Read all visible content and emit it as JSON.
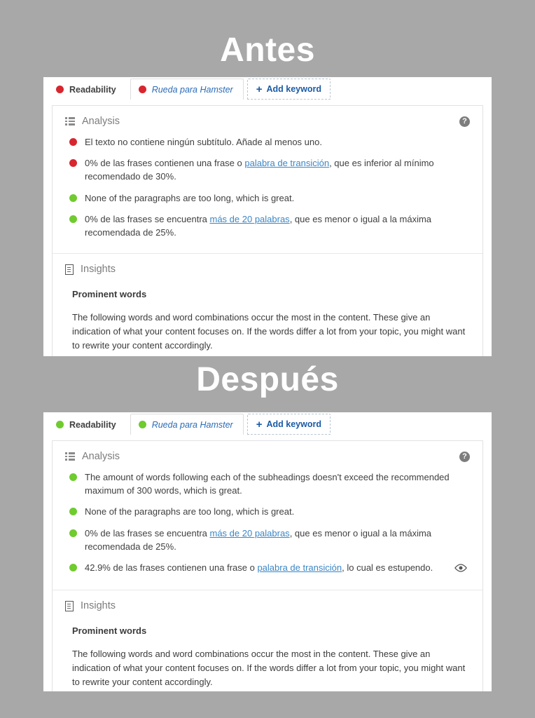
{
  "headings": {
    "before": "Antes",
    "after": "Después"
  },
  "panels": [
    {
      "id": "before",
      "tabs": {
        "readability": {
          "label": "Readability",
          "dot_color": "red"
        },
        "keyword": {
          "label": "Rueda para Hamster",
          "dot_color": "red"
        },
        "add_keyword": {
          "label": "Add keyword",
          "icon": "plus-icon"
        }
      },
      "analysis": {
        "title": "Analysis",
        "icon": "list-icon",
        "help_icon": "help-icon",
        "help_glyph": "?",
        "items": [
          {
            "bullet": "red",
            "parts": [
              {
                "type": "text",
                "value": "El texto no contiene ningún subtítulo. Añade al menos uno."
              }
            ]
          },
          {
            "bullet": "red",
            "parts": [
              {
                "type": "text",
                "value": "0% de las frases contienen una frase o "
              },
              {
                "type": "link",
                "value": "palabra de transición"
              },
              {
                "type": "text",
                "value": ", que es inferior al mínimo recomendado de 30%."
              }
            ]
          },
          {
            "bullet": "green",
            "parts": [
              {
                "type": "text",
                "value": "None of the paragraphs are too long, which is great."
              }
            ]
          },
          {
            "bullet": "green",
            "parts": [
              {
                "type": "text",
                "value": "0% de las frases se encuentra "
              },
              {
                "type": "link",
                "value": "más de 20 palabras"
              },
              {
                "type": "text",
                "value": ", que es menor o igual a la máxima recomendada de 25%."
              }
            ]
          }
        ]
      },
      "insights": {
        "title": "Insights",
        "icon": "doc-icon",
        "prominent_words_title": "Prominent words",
        "paragraph": "The following words and word combinations occur the most in the content. These give an indication of what your content focuses on. If the words differ a lot from your topic, you might want to rewrite your content accordingly."
      }
    },
    {
      "id": "after",
      "tabs": {
        "readability": {
          "label": "Readability",
          "dot_color": "green"
        },
        "keyword": {
          "label": "Rueda para Hamster",
          "dot_color": "green"
        },
        "add_keyword": {
          "label": "Add keyword",
          "icon": "plus-icon"
        }
      },
      "analysis": {
        "title": "Analysis",
        "icon": "list-icon",
        "help_icon": "help-icon",
        "help_glyph": "?",
        "items": [
          {
            "bullet": "green",
            "parts": [
              {
                "type": "text",
                "value": "The amount of words following each of the subheadings doesn't exceed the recommended maximum of 300 words, which is great."
              }
            ]
          },
          {
            "bullet": "green",
            "parts": [
              {
                "type": "text",
                "value": "None of the paragraphs are too long, which is great."
              }
            ]
          },
          {
            "bullet": "green",
            "parts": [
              {
                "type": "text",
                "value": "0% de las frases se encuentra "
              },
              {
                "type": "link",
                "value": "más de 20 palabras"
              },
              {
                "type": "text",
                "value": ", que es menor o igual a la máxima recomendada de 25%."
              }
            ]
          },
          {
            "bullet": "green",
            "trailing_icon": "eye-icon",
            "parts": [
              {
                "type": "text",
                "value": "42.9% de las frases contienen una frase o "
              },
              {
                "type": "link",
                "value": "palabra de transición"
              },
              {
                "type": "text",
                "value": ", lo cual es estupendo."
              }
            ]
          }
        ]
      },
      "insights": {
        "title": "Insights",
        "icon": "doc-icon",
        "prominent_words_title": "Prominent words",
        "paragraph": "The following words and word combinations occur the most in the content. These give an indication of what your content focuses on. If the words differ a lot from your topic, you might want to rewrite your content accordingly."
      }
    }
  ],
  "colors": {
    "background": "#a8a8a8",
    "bullet_red": "#d8262f",
    "bullet_green": "#6fcb2e",
    "link": "#3c86c4",
    "tab_link": "#2b6cb8"
  }
}
